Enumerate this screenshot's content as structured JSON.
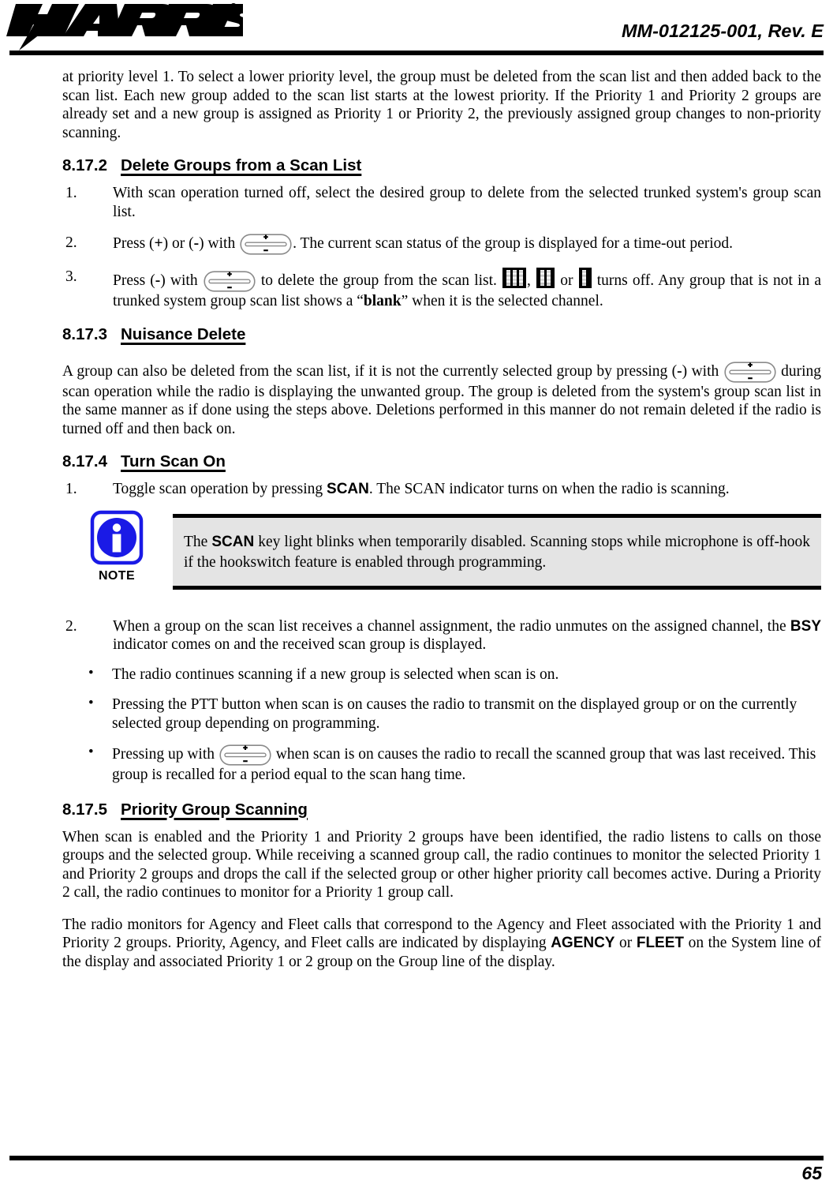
{
  "header": {
    "logo_text": "HARRIS",
    "doc_number": "MM-012125-001, Rev. E"
  },
  "footer": {
    "page_number": "65"
  },
  "content": {
    "intro_paragraph": "at priority level 1. To select a lower priority level, the group must be deleted from the scan list and then added back to the scan list. Each new group added to the scan list starts at the lowest priority. If the Priority 1 and Priority 2 groups are already set and a new group is assigned as Priority 1 or Priority 2, the previously assigned group changes to non-priority scanning.",
    "section_8_17_2": {
      "number": "8.17.2",
      "title": "Delete Groups from a Scan List",
      "step1_num": "1.",
      "step1_text": "With scan operation turned off, select the desired group to delete from the selected trunked system's group scan list.",
      "step2_num": "2.",
      "step2_a": "Press (",
      "step2_plus": "+",
      "step2_b": ") or (",
      "step2_minus": "-",
      "step2_c": ") with ",
      "step2_d": ". The current scan status of the group is displayed for a time-out period.",
      "step3_num": "3.",
      "step3_a": "Press (",
      "step3_minus": "-",
      "step3_b": ") with ",
      "step3_c": " to delete the group from the scan list. ",
      "step3_sep1": ", ",
      "step3_sep2": " or ",
      "step3_d": " turns off. Any group that is not in a trunked system group scan list shows a “",
      "step3_blank": "blank",
      "step3_e": "” when it is the selected channel."
    },
    "section_8_17_3": {
      "number": "8.17.3",
      "title": "Nuisance Delete",
      "para_a": "A group can also be deleted from the scan list, if it is not the currently selected group by pressing (",
      "para_minus": "-",
      "para_b": ") with ",
      "para_c": " during scan operation while the radio is displaying the unwanted group. The group is deleted from the system's group scan list in the same manner as if done using the steps above. Deletions performed in this manner do not remain deleted if the radio is turned off and then back on."
    },
    "section_8_17_4": {
      "number": "8.17.4",
      "title": "Turn Scan On",
      "step1_num": "1.",
      "step1_a": "Toggle scan operation by pressing ",
      "step1_scan": "SCAN",
      "step1_b": ". The SCAN indicator turns on when the radio is scanning.",
      "note": {
        "label": "NOTE",
        "icon": "info-icon",
        "text_a": "The ",
        "text_scan": "SCAN",
        "text_b": " key light blinks when temporarily disabled. Scanning stops while microphone is off-hook if the hookswitch feature is enabled through programming.",
        "bg_color": "#e4e4e4",
        "icon_color": "#1a1ae6"
      },
      "step2_num": "2.",
      "step2_a": "When a group on the scan list receives a channel assignment, the radio unmutes on the assigned channel, the ",
      "step2_bsy": "BSY",
      "step2_b": " indicator comes on and the received scan group is displayed.",
      "bullets": [
        {
          "marker": "•",
          "text": "The radio continues scanning if a new group is selected when scan is on."
        },
        {
          "marker": "•",
          "text": "Pressing the PTT button when scan is on causes the radio to transmit on the displayed group or on the currently selected group depending on programming."
        },
        {
          "marker": "•",
          "text_a": "Pressing up with ",
          "text_b": " when scan is on causes the radio to recall the scanned group that was last received. This group is recalled for a period equal to the scan hang time."
        }
      ]
    },
    "section_8_17_5": {
      "number": "8.17.5",
      "title": "Priority Group Scanning",
      "para1": "When scan is enabled and the Priority 1 and Priority 2 groups have been identified, the radio listens to calls on those groups and the selected group. While receiving a scanned group call, the radio continues to monitor the selected Priority 1 and Priority 2 groups and drops the call if the selected group or other higher priority call becomes active. During a Priority 2 call, the radio continues to monitor for a Priority 1 group call.",
      "para2_a": "The radio monitors for Agency and Fleet calls that correspond to the Agency and Fleet associated with the Priority 1 and Priority 2 groups. Priority, Agency, and Fleet calls are indicated by displaying ",
      "para2_agency": "AGENCY",
      "para2_or": " or ",
      "para2_fleet": "FLEET",
      "para2_b": " on the System line of the display and associated Priority 1 or 2 group on the Group line of the display."
    },
    "icons": {
      "rocker_switch": "rocker-switch-icon",
      "rocker_plus": "+",
      "rocker_minus": "-",
      "scan_indicator_3": "scan-indicator-3-bar-icon",
      "scan_indicator_2": "scan-indicator-2-bar-icon",
      "scan_indicator_1": "scan-indicator-1-bar-icon"
    }
  }
}
